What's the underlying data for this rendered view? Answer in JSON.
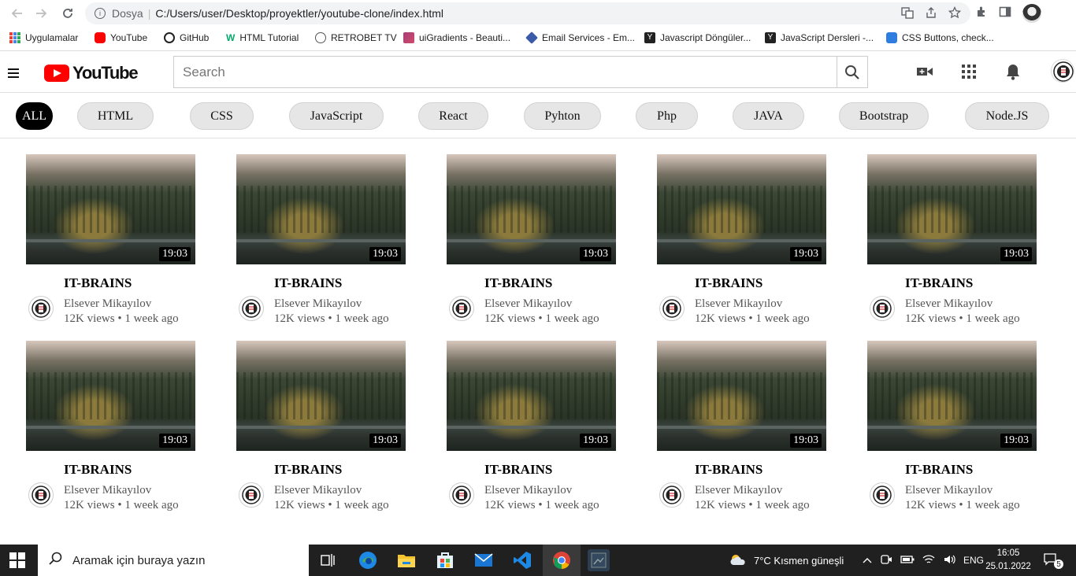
{
  "browser": {
    "omnibox_label": "Dosya",
    "url": "C:/Users/user/Desktop/proyektler/youtube-clone/index.html",
    "bookmarks": [
      {
        "label": "Uygulamalar",
        "icon": "apps-grid-icon"
      },
      {
        "label": "YouTube",
        "icon": "youtube-icon"
      },
      {
        "label": "GitHub",
        "icon": "github-icon"
      },
      {
        "label": "HTML Tutorial",
        "icon": "w3schools-icon"
      },
      {
        "label": "RETROBET TV",
        "icon": "globe-icon"
      },
      {
        "label": "uiGradients - Beauti...",
        "icon": "gradient-icon"
      },
      {
        "label": "Email Services - Em...",
        "icon": "email-icon"
      },
      {
        "label": "Javascript Döngüler...",
        "icon": "y-icon"
      },
      {
        "label": "JavaScript Dersleri -...",
        "icon": "y-icon"
      },
      {
        "label": "CSS Buttons, check...",
        "icon": "css-icon"
      }
    ]
  },
  "header": {
    "logo_text": "YouTube",
    "search_placeholder": "Search"
  },
  "chips": [
    "ALL",
    "HTML",
    "CSS",
    "JavaScript",
    "React",
    "Pyhton",
    "Php",
    "JAVA",
    "Bootstrap",
    "Node.JS"
  ],
  "videos": [
    {
      "duration": "19:03",
      "title": "IT-BRAINS",
      "channel": "Elsever Mikayılov",
      "meta": "12K views • 1 week ago"
    },
    {
      "duration": "19:03",
      "title": "IT-BRAINS",
      "channel": "Elsever Mikayılov",
      "meta": "12K views • 1 week ago"
    },
    {
      "duration": "19:03",
      "title": "IT-BRAINS",
      "channel": "Elsever Mikayılov",
      "meta": "12K views • 1 week ago"
    },
    {
      "duration": "19:03",
      "title": "IT-BRAINS",
      "channel": "Elsever Mikayılov",
      "meta": "12K views • 1 week ago"
    },
    {
      "duration": "19:03",
      "title": "IT-BRAINS",
      "channel": "Elsever Mikayılov",
      "meta": "12K views • 1 week ago"
    },
    {
      "duration": "19:03",
      "title": "IT-BRAINS",
      "channel": "Elsever Mikayılov",
      "meta": "12K views • 1 week ago"
    },
    {
      "duration": "19:03",
      "title": "IT-BRAINS",
      "channel": "Elsever Mikayılov",
      "meta": "12K views • 1 week ago"
    },
    {
      "duration": "19:03",
      "title": "IT-BRAINS",
      "channel": "Elsever Mikayılov",
      "meta": "12K views • 1 week ago"
    },
    {
      "duration": "19:03",
      "title": "IT-BRAINS",
      "channel": "Elsever Mikayılov",
      "meta": "12K views • 1 week ago"
    },
    {
      "duration": "19:03",
      "title": "IT-BRAINS",
      "channel": "Elsever Mikayılov",
      "meta": "12K views • 1 week ago"
    }
  ],
  "taskbar": {
    "search_placeholder": "Aramak için buraya yazın",
    "weather": "7°C  Kısmen güneşli",
    "language": "ENG",
    "time": "16:05",
    "date": "25.01.2022",
    "notification_count": "5"
  },
  "colors": {
    "brand_red": "#ff0000",
    "chip_bg": "#e6e6e6",
    "taskbar_bg": "#202020"
  }
}
